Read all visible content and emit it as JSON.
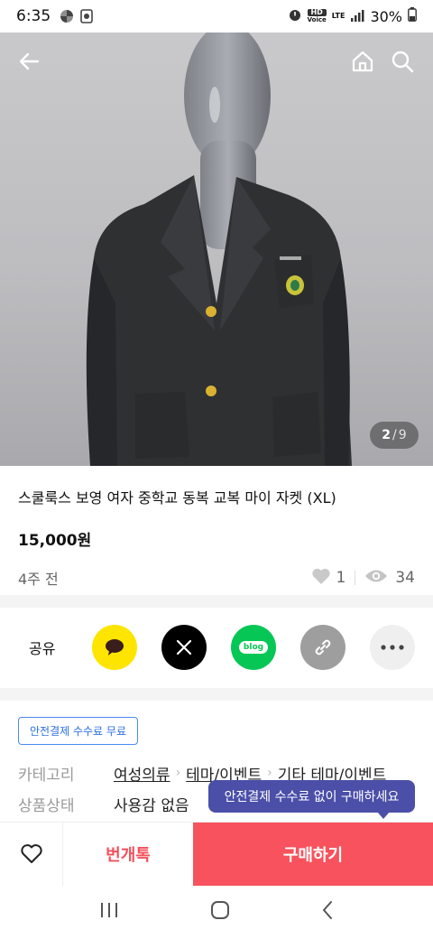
{
  "status_bar": {
    "time": "6:35",
    "hd_top": "HD",
    "hd_bottom": "Voice",
    "network": "LTE",
    "battery": "30%"
  },
  "product": {
    "page_current": "2",
    "page_sep": "/",
    "page_total": "9",
    "title": "스쿨룩스 보영 여자 중학교 동복 교복 마이 자켓 (XL)",
    "price": "15,000원",
    "posted": "4주 전",
    "likes": "1",
    "views": "34"
  },
  "share": {
    "label": "공유",
    "kakao_color": "#FEE500",
    "x_color": "#000000",
    "band_color": "#06C755",
    "band_text": "blog",
    "link_color": "#9e9e9e",
    "more_color": "#efefef"
  },
  "details": {
    "badge": "안전결제 수수료 무료",
    "category_label": "카테고리",
    "category_1": "여성의류",
    "category_2": "테마/이벤트",
    "category_3": "기타 테마/이벤트",
    "condition_label": "상품상태",
    "condition_value": "사용감 없음"
  },
  "tooltip": "안전결제 수수료 없이 구매하세요",
  "actions": {
    "chat": "번개톡",
    "buy": "구매하기",
    "buy_color": "#F7525D"
  }
}
